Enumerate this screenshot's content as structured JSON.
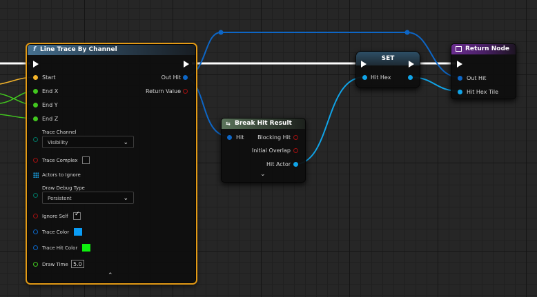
{
  "line_trace": {
    "title": "Line Trace By Channel",
    "func_glyph": "f",
    "inputs": [
      "Start",
      "End X",
      "End Y",
      "End Z"
    ],
    "outputs": [
      "Out Hit",
      "Return Value"
    ],
    "trace_channel_label": "Trace Channel",
    "trace_channel_value": "Visibility",
    "trace_complex_label": "Trace Complex",
    "actors_to_ignore_label": "Actors to Ignore",
    "draw_debug_type_label": "Draw Debug Type",
    "draw_debug_type_value": "Persistent",
    "ignore_self_label": "Ignore Self",
    "trace_color_label": "Trace Color",
    "trace_hit_color_label": "Trace Hit Color",
    "draw_time_label": "Draw Time",
    "draw_time_value": "5.0",
    "trace_color": "#0a9cf5",
    "trace_hit_color": "#0ef00e"
  },
  "break_hit": {
    "title": "Break Hit Result",
    "input": "Hit",
    "outputs": [
      "Blocking Hit",
      "Initial Overlap",
      "Hit Actor"
    ]
  },
  "set_node": {
    "title": "SET",
    "pin": "Hit Hex"
  },
  "return_node": {
    "title": "Return Node",
    "inputs": [
      "Out Hit",
      "Hit Hex Tile"
    ]
  },
  "colors": {
    "exec": "#ffffff",
    "struct": "#0d66c6",
    "object": "#10a4e8",
    "bool": "#8c0000",
    "vector": "#f5b52a",
    "float": "#42c71f",
    "byte": "#007563",
    "accent": "#e39a15"
  }
}
